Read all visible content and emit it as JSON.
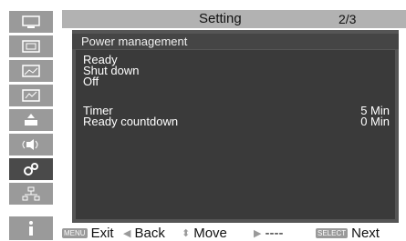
{
  "header": {
    "title": "Setting",
    "page": "2/3"
  },
  "submenu": {
    "title": "Power management"
  },
  "options": [
    {
      "label": "Ready"
    },
    {
      "label": "Shut down"
    },
    {
      "label": "Off"
    }
  ],
  "settings": [
    {
      "label": "Timer",
      "value": "5 Min"
    },
    {
      "label": "Ready countdown",
      "value": "0 Min"
    }
  ],
  "footer": {
    "exit": {
      "key": "MENU",
      "label": "Exit"
    },
    "back": {
      "label": "Back"
    },
    "move": {
      "label": "Move"
    },
    "forward": {
      "label": "----"
    },
    "next": {
      "key": "SELECT",
      "label": "Next"
    }
  },
  "sidebar": {
    "icons": [
      "display-icon",
      "computer-icon",
      "image-icon",
      "image-adjust-icon",
      "setting-icon",
      "sound-icon",
      "gear-icon",
      "network-icon",
      "info-icon"
    ],
    "active": "gear-icon"
  },
  "colors": {
    "header": "#b2b2b2",
    "panel": "#555555",
    "content": "#3a3a3a",
    "sidebar_icon": "#9a9a9a",
    "sidebar_active": "#4a4a4a"
  }
}
